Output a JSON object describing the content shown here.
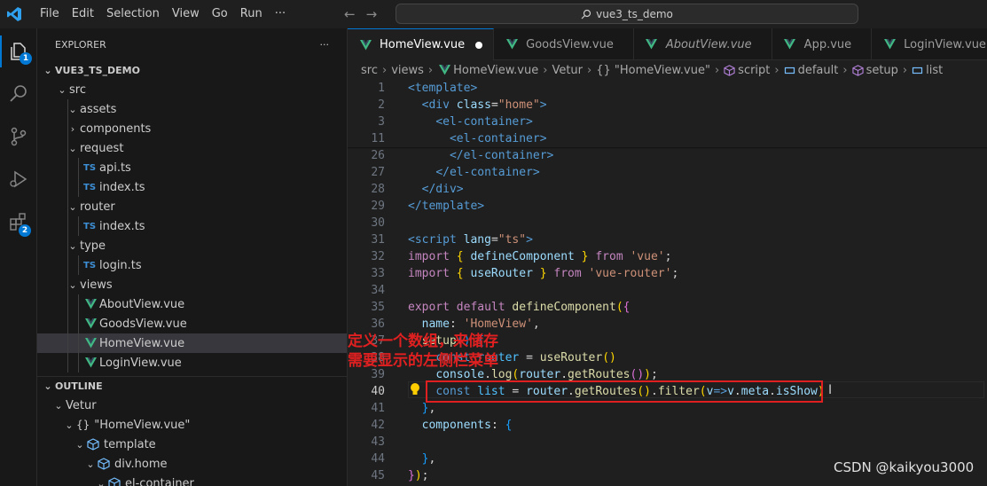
{
  "window": {
    "menu": [
      "File",
      "Edit",
      "Selection",
      "View",
      "Go",
      "Run"
    ],
    "more": "···",
    "search_text": "vue3_ts_demo"
  },
  "activity_bar": {
    "explorer_badge": "1",
    "extensions_badge": "2"
  },
  "explorer": {
    "title": "EXPLORER",
    "more": "···",
    "project": "VUE3_TS_DEMO",
    "tree": [
      {
        "label": "src",
        "type": "folder",
        "depth": 1,
        "open": true
      },
      {
        "label": "assets",
        "type": "folder",
        "depth": 2,
        "open": true
      },
      {
        "label": "components",
        "type": "folder",
        "depth": 2,
        "open": false
      },
      {
        "label": "request",
        "type": "folder",
        "depth": 2,
        "open": true
      },
      {
        "label": "api.ts",
        "type": "ts",
        "depth": 3
      },
      {
        "label": "index.ts",
        "type": "ts",
        "depth": 3
      },
      {
        "label": "router",
        "type": "folder",
        "depth": 2,
        "open": true
      },
      {
        "label": "index.ts",
        "type": "ts",
        "depth": 3
      },
      {
        "label": "type",
        "type": "folder",
        "depth": 2,
        "open": true
      },
      {
        "label": "login.ts",
        "type": "ts",
        "depth": 3
      },
      {
        "label": "views",
        "type": "folder",
        "depth": 2,
        "open": true
      },
      {
        "label": "AboutView.vue",
        "type": "vue",
        "depth": 3
      },
      {
        "label": "GoodsView.vue",
        "type": "vue",
        "depth": 3
      },
      {
        "label": "HomeView.vue",
        "type": "vue",
        "depth": 3,
        "selected": true
      },
      {
        "label": "LoginView.vue",
        "type": "vue",
        "depth": 3
      }
    ],
    "ts_badge": "TS"
  },
  "outline": {
    "title": "OUTLINE",
    "items": [
      {
        "label": "Vetur",
        "icon": "",
        "depth": 1
      },
      {
        "label": "\"HomeView.vue\"",
        "icon": "{}",
        "depth": 2
      },
      {
        "label": "template",
        "icon": "cube",
        "depth": 3
      },
      {
        "label": "div.home",
        "icon": "cube",
        "depth": 4
      },
      {
        "label": "el-container",
        "icon": "cube",
        "depth": 5
      }
    ]
  },
  "tabs": [
    {
      "label": "HomeView.vue",
      "active": true,
      "dirty": true
    },
    {
      "label": "GoodsView.vue",
      "active": false
    },
    {
      "label": "AboutView.vue",
      "active": false,
      "italic": true
    },
    {
      "label": "App.vue",
      "active": false
    },
    {
      "label": "LoginView.vue",
      "active": false
    }
  ],
  "breadcrumbs": [
    "src",
    "views",
    "HomeView.vue",
    "Vetur",
    "{} \"HomeView.vue\"",
    "script",
    "default",
    "setup",
    "list"
  ],
  "code": {
    "lines": [
      {
        "n": "1",
        "tokens": [
          [
            "tag",
            "<template>"
          ]
        ]
      },
      {
        "n": "2",
        "tokens": [
          [
            "plain",
            "  "
          ],
          [
            "tag",
            "<div "
          ],
          [
            "attr",
            "class"
          ],
          [
            "plain",
            "="
          ],
          [
            "str",
            "\"home\""
          ],
          [
            "tag",
            ">"
          ]
        ]
      },
      {
        "n": "3",
        "tokens": [
          [
            "plain",
            "    "
          ],
          [
            "tag",
            "<el-container>"
          ]
        ]
      },
      {
        "n": "11",
        "tokens": [
          [
            "plain",
            "      "
          ],
          [
            "tag",
            "<el-container>"
          ]
        ]
      },
      {
        "n": "26",
        "tokens": [
          [
            "plain",
            "      "
          ],
          [
            "tag",
            "</el-container>"
          ]
        ]
      },
      {
        "n": "27",
        "tokens": [
          [
            "plain",
            "    "
          ],
          [
            "tag",
            "</el-container>"
          ]
        ]
      },
      {
        "n": "28",
        "tokens": [
          [
            "plain",
            "  "
          ],
          [
            "tag",
            "</div>"
          ]
        ]
      },
      {
        "n": "29",
        "tokens": [
          [
            "tag",
            "</template>"
          ]
        ]
      },
      {
        "n": "30",
        "tokens": []
      },
      {
        "n": "31",
        "tokens": [
          [
            "tag",
            "<script "
          ],
          [
            "attr",
            "lang"
          ],
          [
            "plain",
            "="
          ],
          [
            "str",
            "\"ts\""
          ],
          [
            "tag",
            ">"
          ]
        ]
      },
      {
        "n": "32",
        "tokens": [
          [
            "ctrl",
            "import "
          ],
          [
            "b1",
            "{ "
          ],
          [
            "var",
            "defineComponent"
          ],
          [
            "b1",
            " }"
          ],
          [
            "ctrl",
            " from "
          ],
          [
            "str",
            "'vue'"
          ],
          [
            "plain",
            ";"
          ]
        ]
      },
      {
        "n": "33",
        "tokens": [
          [
            "ctrl",
            "import "
          ],
          [
            "b1",
            "{ "
          ],
          [
            "var",
            "useRouter"
          ],
          [
            "b1",
            " }"
          ],
          [
            "ctrl",
            " from "
          ],
          [
            "str",
            "'vue-router'"
          ],
          [
            "plain",
            ";"
          ]
        ]
      },
      {
        "n": "34",
        "tokens": []
      },
      {
        "n": "35",
        "tokens": [
          [
            "ctrl",
            "export "
          ],
          [
            "ctrl",
            "default "
          ],
          [
            "fn",
            "defineComponent"
          ],
          [
            "b1",
            "("
          ],
          [
            "b2",
            "{"
          ]
        ]
      },
      {
        "n": "36",
        "tokens": [
          [
            "plain",
            "  "
          ],
          [
            "var",
            "name"
          ],
          [
            "plain",
            ": "
          ],
          [
            "str",
            "'HomeView'"
          ],
          [
            "plain",
            ","
          ]
        ]
      },
      {
        "n": "37",
        "tokens": [
          [
            "plain",
            "  "
          ],
          [
            "fn",
            "setup"
          ],
          [
            "b3",
            "()"
          ],
          [
            "plain",
            " "
          ],
          [
            "b3",
            "{"
          ]
        ]
      },
      {
        "n": "38",
        "tokens": [
          [
            "plain",
            "    "
          ],
          [
            "kw",
            "const "
          ],
          [
            "const",
            "router"
          ],
          [
            "plain",
            " = "
          ],
          [
            "fn",
            "useRouter"
          ],
          [
            "b1",
            "()"
          ]
        ]
      },
      {
        "n": "39",
        "tokens": [
          [
            "plain",
            "    "
          ],
          [
            "var",
            "console"
          ],
          [
            "plain",
            "."
          ],
          [
            "fn",
            "log"
          ],
          [
            "b1",
            "("
          ],
          [
            "var",
            "router"
          ],
          [
            "plain",
            "."
          ],
          [
            "fn",
            "getRoutes"
          ],
          [
            "b2",
            "()"
          ],
          [
            "b1",
            ")"
          ],
          [
            "plain",
            ";"
          ]
        ]
      },
      {
        "n": "40",
        "tokens": [
          [
            "plain",
            "    "
          ],
          [
            "kw",
            "const "
          ],
          [
            "const",
            "list"
          ],
          [
            "plain",
            " = "
          ],
          [
            "var",
            "router"
          ],
          [
            "plain",
            "."
          ],
          [
            "fn",
            "getRoutes"
          ],
          [
            "b1",
            "()"
          ],
          [
            "plain",
            "."
          ],
          [
            "fn",
            "filter"
          ],
          [
            "b1",
            "("
          ],
          [
            "var",
            "v"
          ],
          [
            "kw",
            "=>"
          ],
          [
            "var",
            "v"
          ],
          [
            "plain",
            "."
          ],
          [
            "var",
            "meta"
          ],
          [
            "plain",
            "."
          ],
          [
            "var",
            "isShow"
          ],
          [
            "b1",
            ")"
          ]
        ],
        "current": true
      },
      {
        "n": "41",
        "tokens": [
          [
            "plain",
            "  "
          ],
          [
            "b3",
            "}"
          ],
          [
            "plain",
            ","
          ]
        ]
      },
      {
        "n": "42",
        "tokens": [
          [
            "plain",
            "  "
          ],
          [
            "var",
            "components"
          ],
          [
            "plain",
            ": "
          ],
          [
            "b3",
            "{"
          ]
        ]
      },
      {
        "n": "43",
        "tokens": []
      },
      {
        "n": "44",
        "tokens": [
          [
            "plain",
            "  "
          ],
          [
            "b3",
            "}"
          ],
          [
            "plain",
            ","
          ]
        ]
      },
      {
        "n": "45",
        "tokens": [
          [
            "b2",
            "}"
          ],
          [
            "b1",
            ")"
          ],
          [
            "plain",
            ";"
          ]
        ]
      }
    ]
  },
  "annotation": {
    "line1": "定义一个数组，来储存",
    "line2": "需要显示的左侧栏菜单"
  },
  "watermark": "CSDN @kaikyou3000",
  "colors": {
    "accent": "#0078d4",
    "annotation_red": "#e02020",
    "vue_green": "#41b883"
  }
}
